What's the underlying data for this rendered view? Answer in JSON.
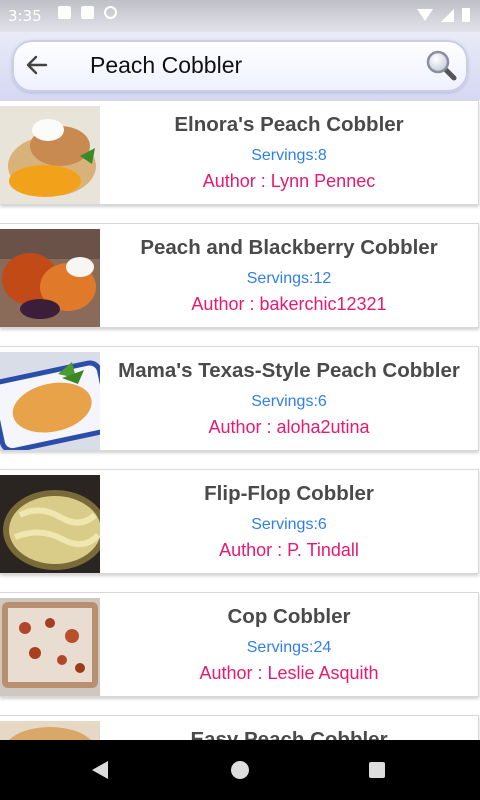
{
  "status": {
    "time": "3:35"
  },
  "search": {
    "value": "Peach Cobbler",
    "placeholder": ""
  },
  "recipes": [
    {
      "title": "Elnora's Peach Cobbler",
      "servings": "Servings:8",
      "author": "Author : Lynn Pennec"
    },
    {
      "title": "Peach and Blackberry Cobbler",
      "servings": "Servings:12",
      "author": "Author : bakerchic12321"
    },
    {
      "title": "Mama's Texas-Style Peach Cobbler",
      "servings": "Servings:6",
      "author": "Author : aloha2utina"
    },
    {
      "title": "Flip-Flop Cobbler",
      "servings": "Servings:6",
      "author": "Author : P.  Tindall"
    },
    {
      "title": "Cop Cobbler",
      "servings": "Servings:24",
      "author": "Author : Leslie Asquith"
    },
    {
      "title": "Easy Peach Cobbler",
      "servings": "",
      "author": ""
    }
  ],
  "colors": {
    "title": "#4a4a4a",
    "servings": "#2f7fe8",
    "author": "#e8196e"
  },
  "icons": {
    "back": "arrow-left-icon",
    "search": "magnifier-icon"
  }
}
